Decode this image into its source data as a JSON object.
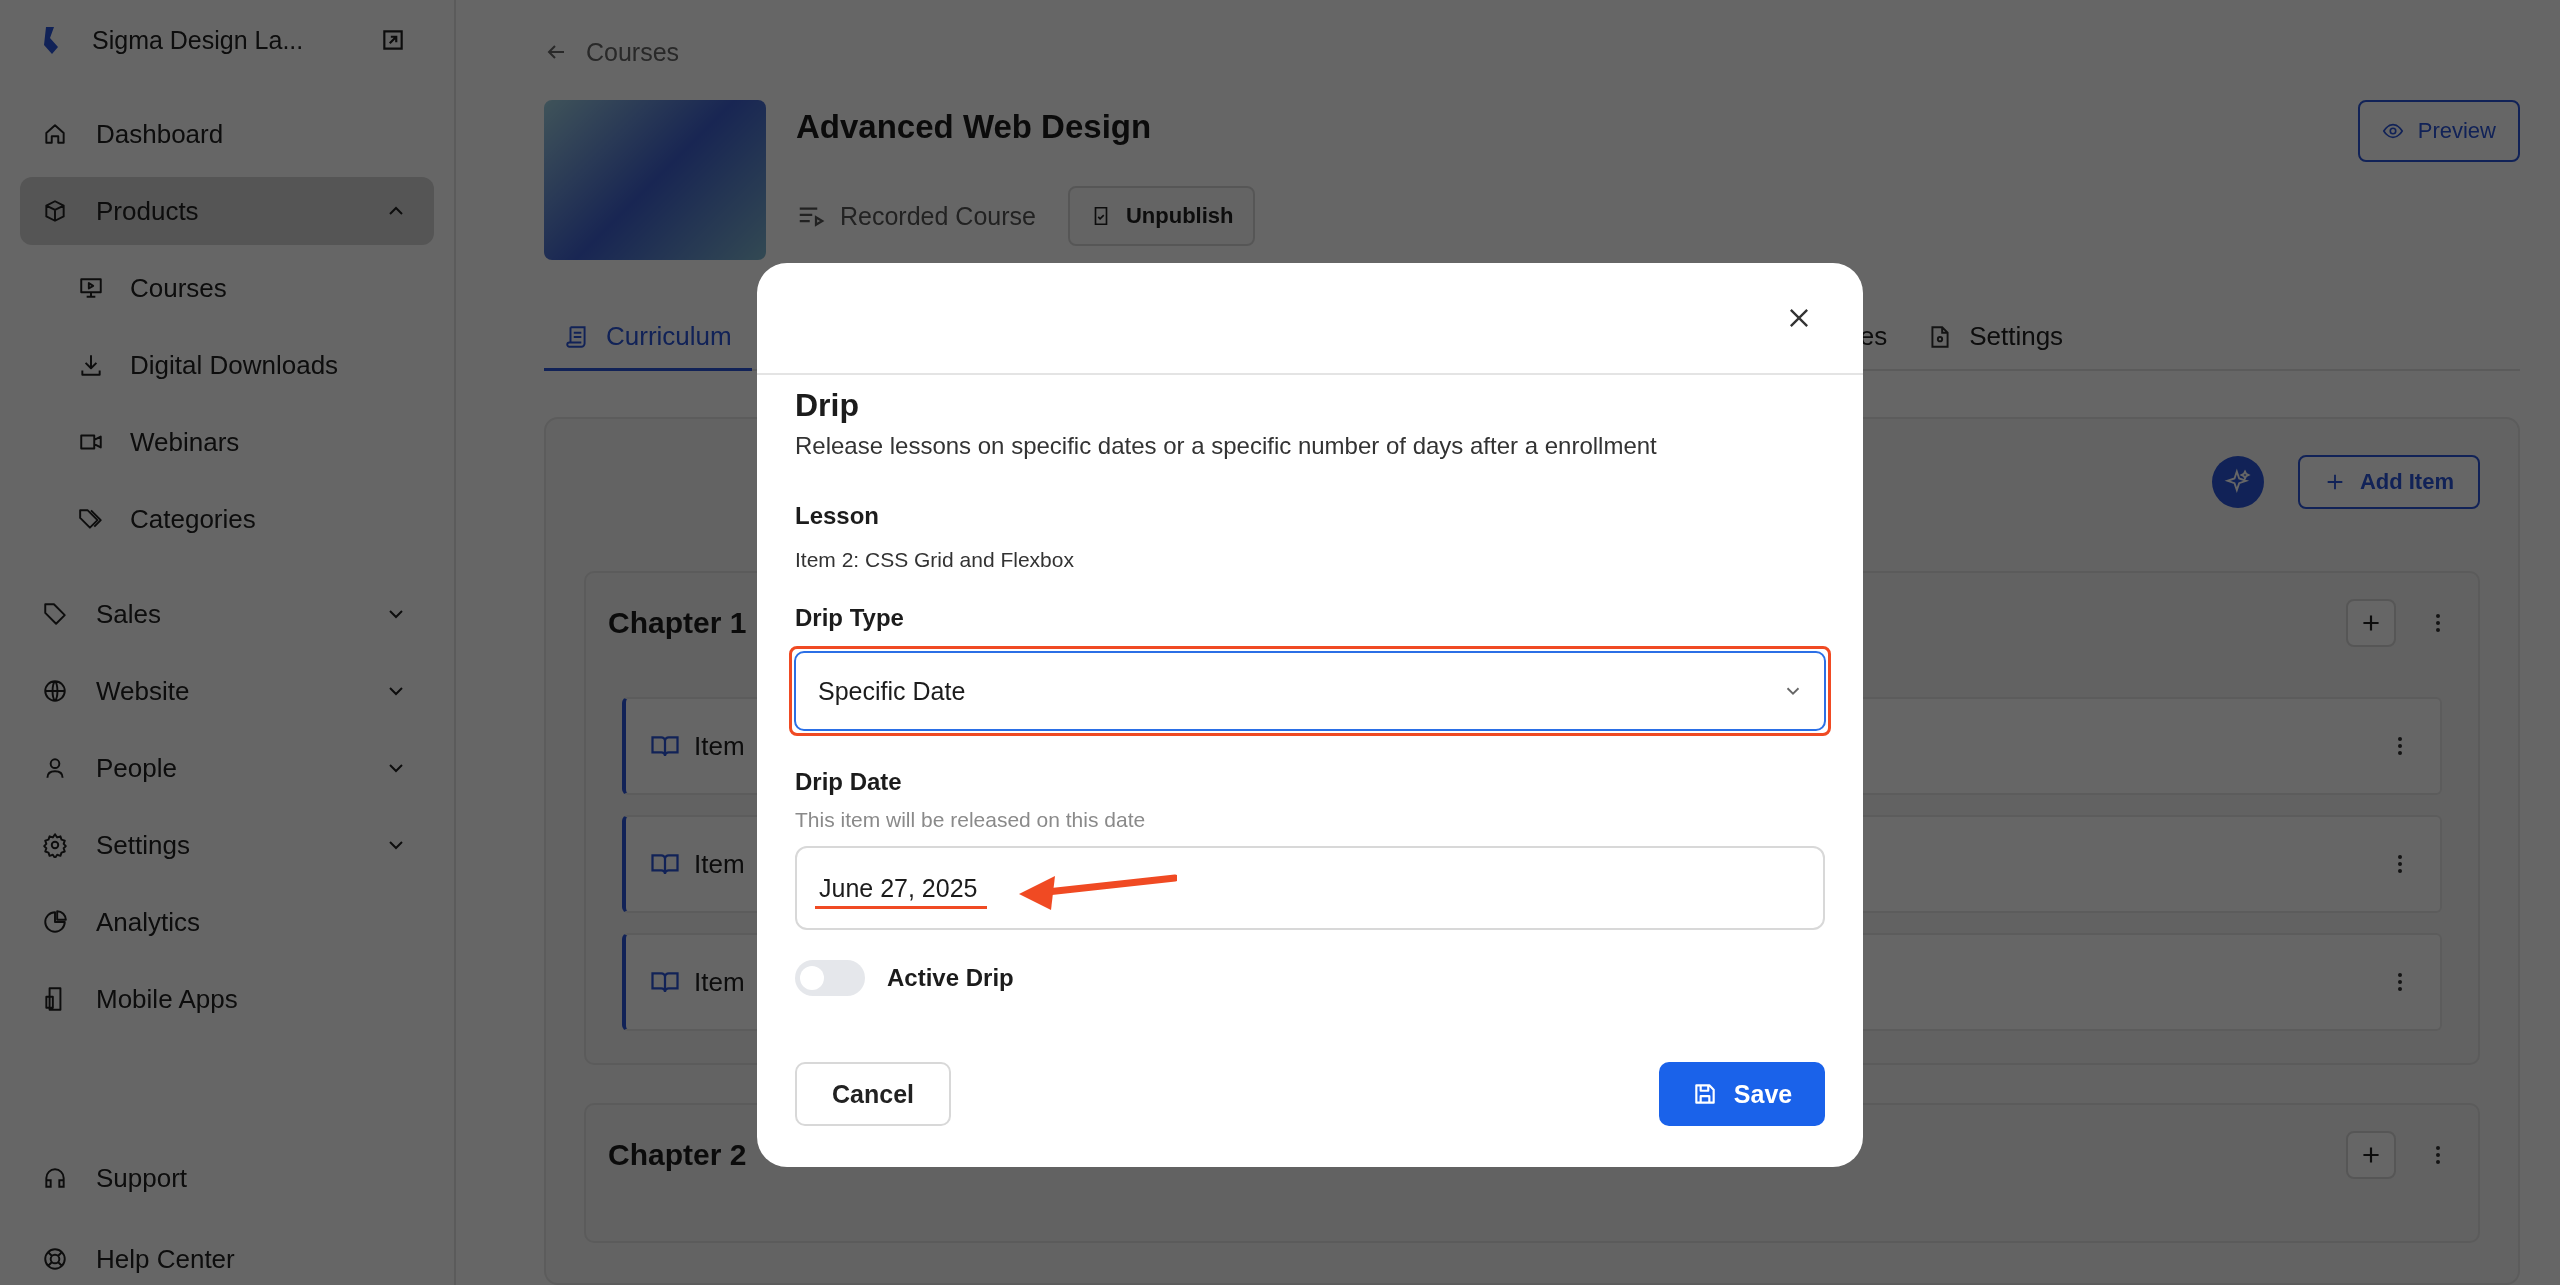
{
  "sidebar": {
    "workspace": "Sigma Design La...",
    "items": [
      {
        "label": "Dashboard",
        "selected": false
      },
      {
        "label": "Products",
        "selected": true,
        "expanded": true,
        "children": [
          {
            "label": "Courses",
            "selected": false
          },
          {
            "label": "Digital Downloads",
            "selected": false
          },
          {
            "label": "Webinars",
            "selected": false
          },
          {
            "label": "Categories",
            "selected": false
          }
        ]
      },
      {
        "label": "Sales",
        "selected": false,
        "expanded": false
      },
      {
        "label": "Website",
        "selected": false,
        "expanded": false
      },
      {
        "label": "People",
        "selected": false,
        "expanded": false
      },
      {
        "label": "Settings",
        "selected": false,
        "expanded": false
      },
      {
        "label": "Analytics",
        "selected": false
      },
      {
        "label": "Mobile Apps",
        "selected": false
      }
    ],
    "footer_items": [
      {
        "label": "Support"
      },
      {
        "label": "Help Center"
      }
    ]
  },
  "breadcrumb": "Courses",
  "course": {
    "title": "Advanced Web Design",
    "type": "Recorded Course",
    "unpublish_button": "Unpublish",
    "preview_button": "Preview"
  },
  "tabs": [
    {
      "label": "Curriculum",
      "selected": true
    },
    {
      "label": "es",
      "selected": false
    },
    {
      "label": "Settings",
      "selected": false
    }
  ],
  "add_item_button": "Add Item",
  "chapters": [
    {
      "title": "Chapter 1",
      "items": [
        "Item",
        "Item",
        "Item"
      ]
    },
    {
      "title": "Chapter 2"
    }
  ],
  "modal": {
    "title": "Drip",
    "description": "Release lessons on specific dates or a specific number of days after a enrollment",
    "lesson_label": "Lesson",
    "lesson_value": "Item 2: CSS Grid and Flexbox",
    "drip_type_label": "Drip Type",
    "drip_type_value": "Specific Date",
    "drip_date_label": "Drip Date",
    "drip_date_hint": "This item will be released on this date",
    "drip_date_value": "June 27, 2025",
    "active_drip": {
      "label": "Active Drip",
      "on": false
    },
    "cancel_button": "Cancel",
    "save_button": "Save"
  }
}
